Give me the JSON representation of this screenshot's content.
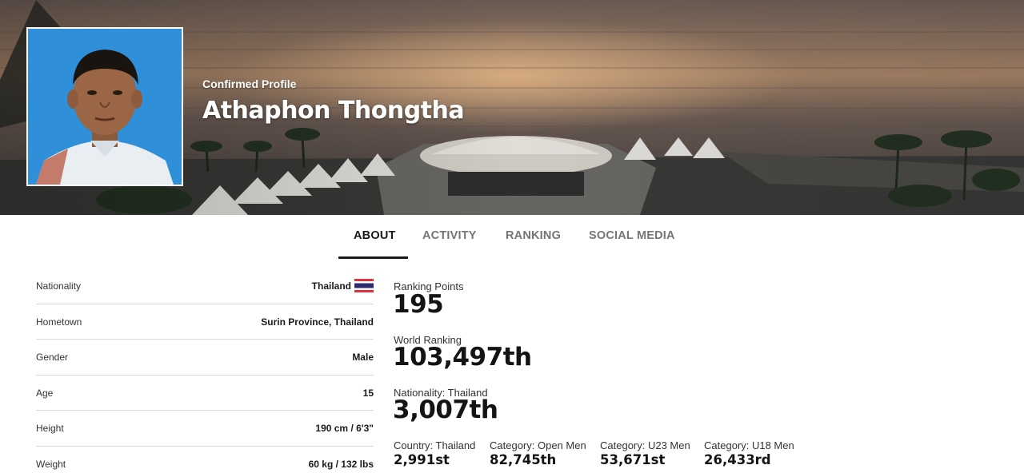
{
  "hero": {
    "status": "Confirmed Profile",
    "name": "Athaphon Thongtha"
  },
  "tabs": [
    {
      "label": "ABOUT",
      "active": true
    },
    {
      "label": "ACTIVITY",
      "active": false
    },
    {
      "label": "RANKING",
      "active": false
    },
    {
      "label": "SOCIAL MEDIA",
      "active": false
    }
  ],
  "info": [
    {
      "label": "Nationality",
      "value": "Thailand",
      "icon": "thailand-flag-icon"
    },
    {
      "label": "Hometown",
      "value": "Surin Province, Thailand"
    },
    {
      "label": "Gender",
      "value": "Male"
    },
    {
      "label": "Age",
      "value": "15"
    },
    {
      "label": "Height",
      "value": "190 cm / 6'3\""
    },
    {
      "label": "Weight",
      "value": "60 kg / 132 lbs"
    }
  ],
  "rankings": {
    "points_label": "Ranking Points",
    "points_value": "195",
    "world_label": "World Ranking",
    "world_value": "103,497th",
    "nationality_label": "Nationality: Thailand",
    "nationality_value": "3,007th",
    "categories": [
      {
        "label": "Country: Thailand",
        "value": "2,991st"
      },
      {
        "label": "Category: Open Men",
        "value": "82,745th"
      },
      {
        "label": "Category: U23 Men",
        "value": "53,671st"
      },
      {
        "label": "Category: U18 Men",
        "value": "26,433rd"
      }
    ]
  },
  "colors": {
    "text_dark": "#1a1a1a",
    "tab_inactive": "#757575",
    "divider": "#d9d9d9",
    "flag_red": "#e0313f",
    "flag_blue": "#2d2a6e"
  }
}
